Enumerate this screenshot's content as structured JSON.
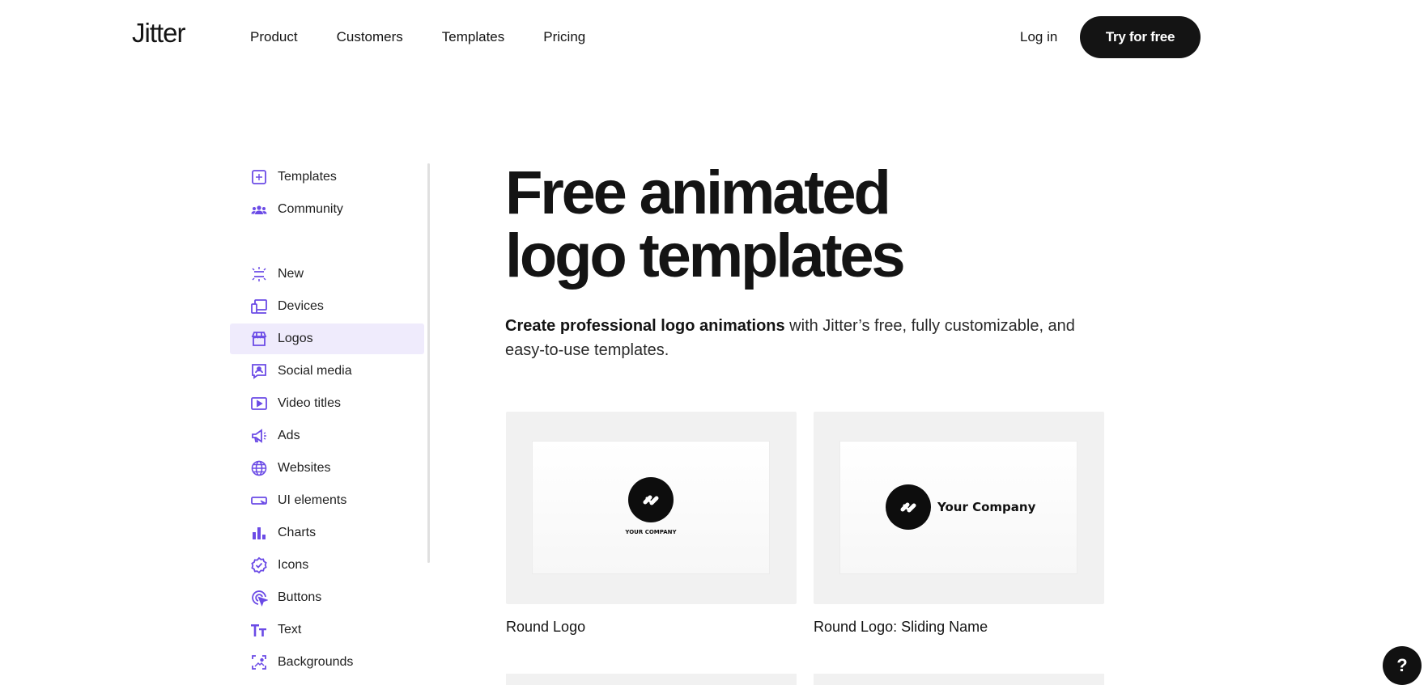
{
  "brand": {
    "name": "Jitter"
  },
  "nav": {
    "items": [
      "Product",
      "Customers",
      "Templates",
      "Pricing"
    ]
  },
  "header": {
    "login_label": "Log in",
    "cta_label": "Try for free"
  },
  "sidebar": {
    "accent_color": "#6b4be6",
    "items": [
      {
        "label": "Templates",
        "icon": "templates-icon"
      },
      {
        "label": "Community",
        "icon": "community-icon"
      },
      {
        "label": "New",
        "icon": "new-icon"
      },
      {
        "label": "Devices",
        "icon": "devices-icon"
      },
      {
        "label": "Logos",
        "icon": "logos-icon",
        "active": true
      },
      {
        "label": "Social media",
        "icon": "social-media-icon"
      },
      {
        "label": "Video titles",
        "icon": "video-titles-icon"
      },
      {
        "label": "Ads",
        "icon": "ads-icon"
      },
      {
        "label": "Websites",
        "icon": "websites-icon"
      },
      {
        "label": "UI elements",
        "icon": "ui-elements-icon"
      },
      {
        "label": "Charts",
        "icon": "charts-icon"
      },
      {
        "label": "Icons",
        "icon": "icons-icon"
      },
      {
        "label": "Buttons",
        "icon": "buttons-icon"
      },
      {
        "label": "Text",
        "icon": "text-icon"
      },
      {
        "label": "Backgrounds",
        "icon": "backgrounds-icon"
      }
    ]
  },
  "hero": {
    "title_line1": "Free animated",
    "title_line2": "logo templates",
    "subtitle_bold": "Create professional logo animations",
    "subtitle_rest": " with Jitter’s free, fully customizable, and easy-to-use templates."
  },
  "cards": [
    {
      "title": "Round Logo",
      "logo_text": "YOUR COMPANY"
    },
    {
      "title": "Round Logo: Sliding Name",
      "logo_text": "Your Company"
    }
  ],
  "help": {
    "label": "?"
  }
}
